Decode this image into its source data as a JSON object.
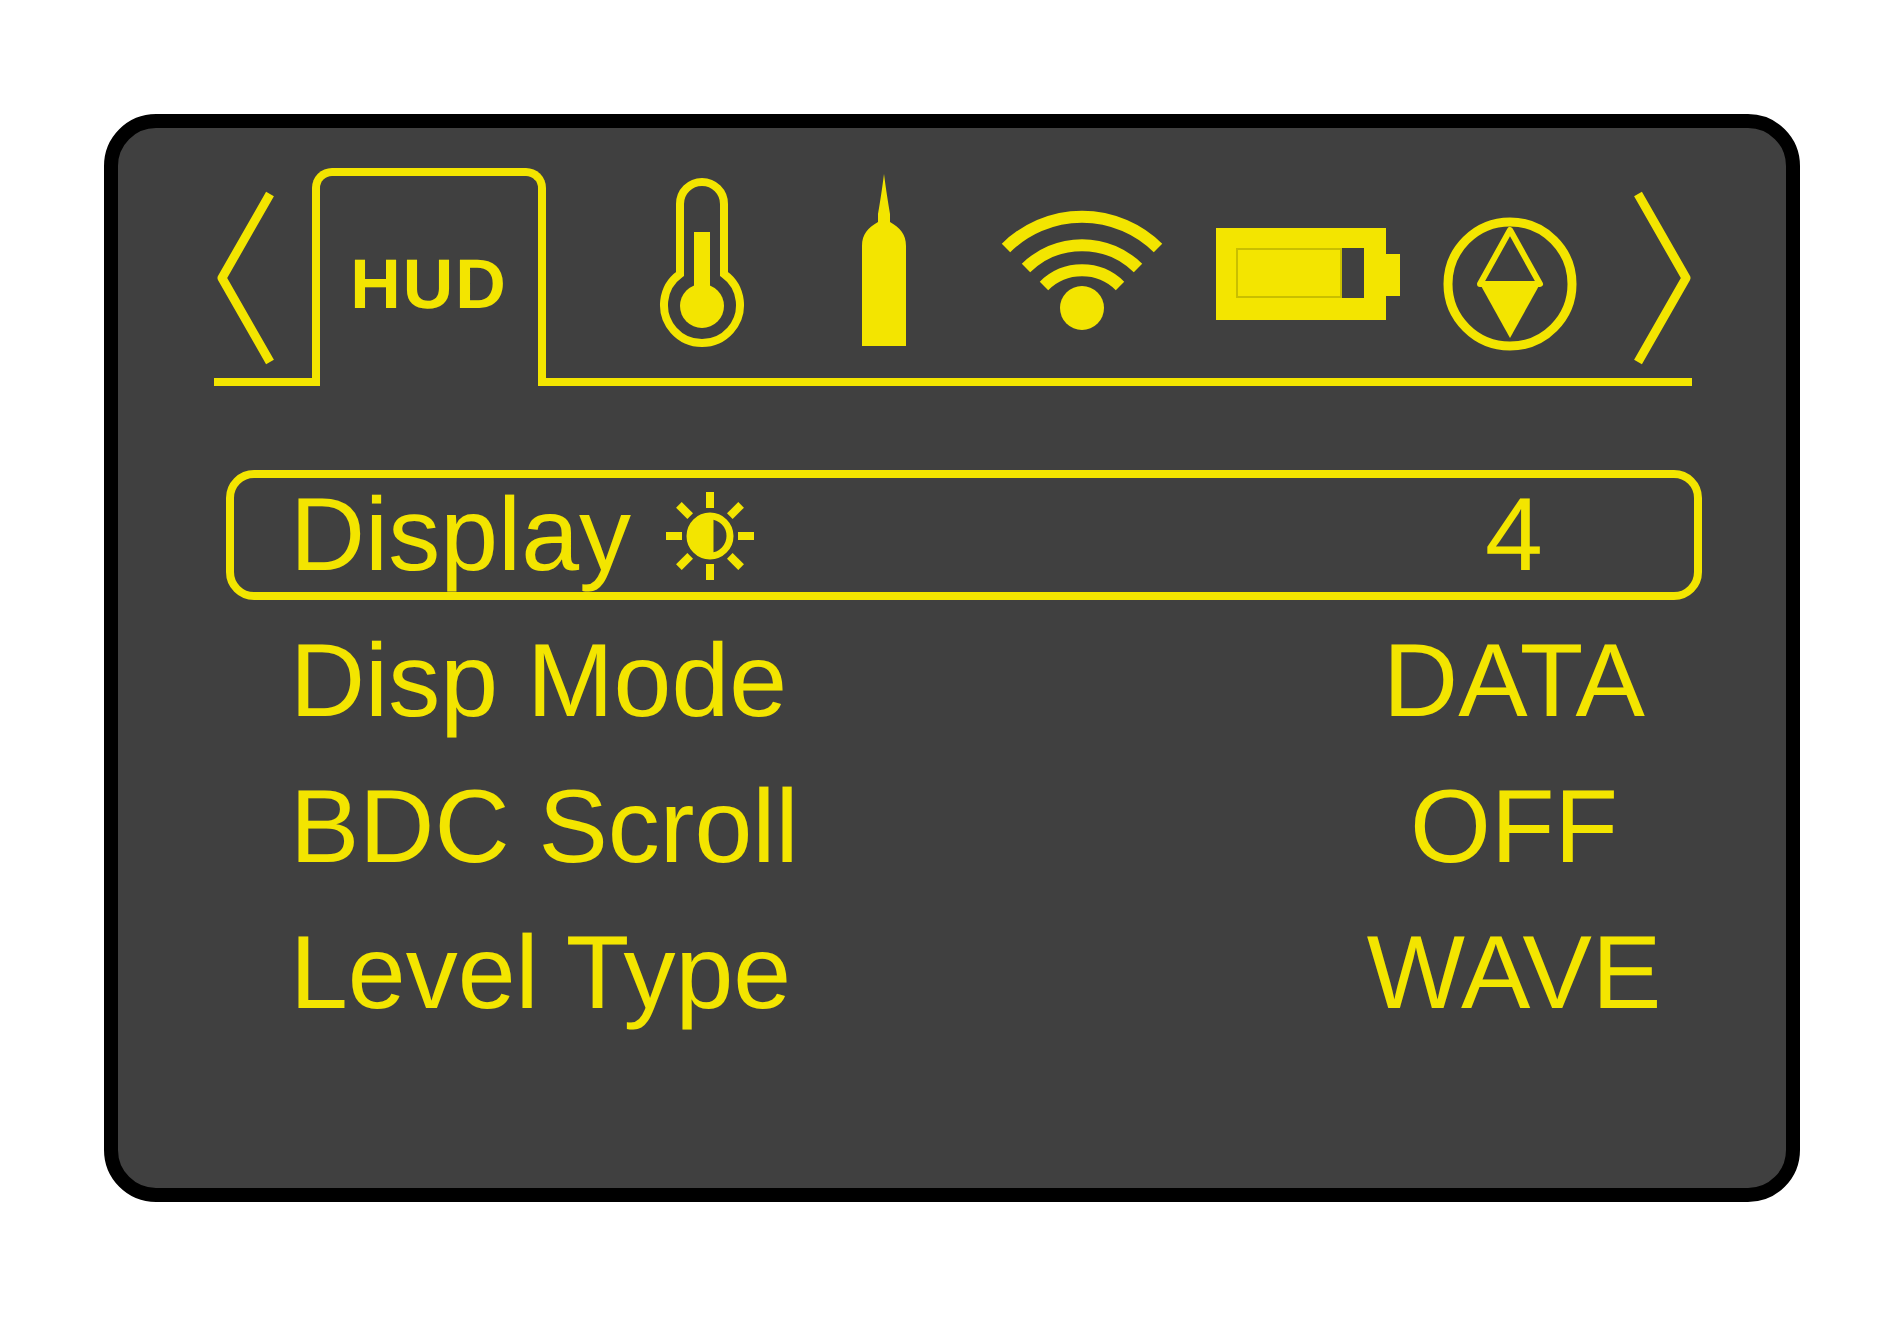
{
  "tabs": [
    {
      "kind": "text",
      "label": "HUD",
      "selected": true
    },
    {
      "kind": "thermometer",
      "selected": false
    },
    {
      "kind": "bullet",
      "selected": false
    },
    {
      "kind": "wifi",
      "selected": false
    },
    {
      "kind": "battery",
      "selected": false
    },
    {
      "kind": "compass",
      "selected": false
    }
  ],
  "menu": [
    {
      "kind": "brightness",
      "label": "Display",
      "value": "4",
      "selected": true
    },
    {
      "kind": "plain",
      "label": "Disp Mode",
      "value": "DATA",
      "selected": false
    },
    {
      "kind": "plain",
      "label": "BDC Scroll",
      "value": "OFF",
      "selected": false
    },
    {
      "kind": "plain",
      "label": "Level Type",
      "value": "WAVE",
      "selected": false
    }
  ]
}
